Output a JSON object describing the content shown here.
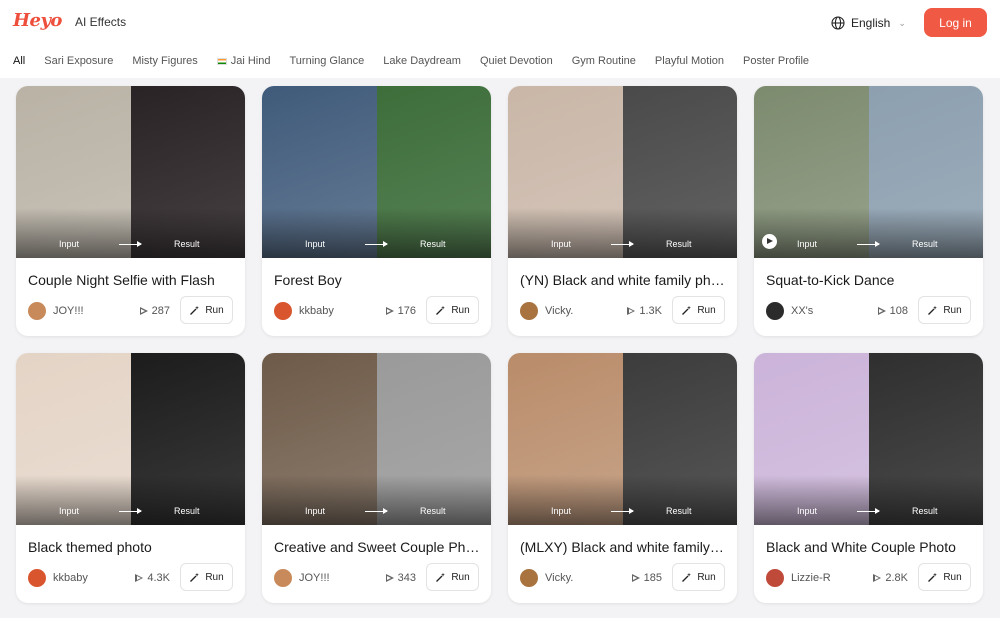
{
  "header": {
    "logo": "Heyo",
    "nav_link": "AI Effects",
    "language": "English",
    "login_label": "Log in"
  },
  "tabs": [
    {
      "label": "All",
      "active": true
    },
    {
      "label": "Sari Exposure"
    },
    {
      "label": "Misty Figures"
    },
    {
      "label": "Jai Hind",
      "flag": "india-flag"
    },
    {
      "label": "Turning Glance"
    },
    {
      "label": "Lake Daydream"
    },
    {
      "label": "Quiet Devotion"
    },
    {
      "label": "Gym Routine"
    },
    {
      "label": "Playful Motion"
    },
    {
      "label": "Poster Profile"
    }
  ],
  "labels": {
    "input": "Input",
    "result": "Result",
    "run": "Run"
  },
  "cards": [
    {
      "title": "Couple Night Selfie with Flash",
      "author": "JOY!!!",
      "plays": "287",
      "left_bg": "#b9b2a5",
      "right_bg": "#2a2326",
      "avatar": "#c88a5a"
    },
    {
      "title": "Forest Boy",
      "author": "kkbaby",
      "plays": "176",
      "left_bg": "#3f5a7a",
      "right_bg": "#3d6e3a",
      "avatar": "#d9552e"
    },
    {
      "title": "(YN) Black and white family photo",
      "author": "Vicky.",
      "plays": "1.3K",
      "left_bg": "#c9b6a7",
      "right_bg": "#4a4a4a",
      "avatar": "#a8733e"
    },
    {
      "title": "Squat-to-Kick Dance",
      "author": "XX's",
      "plays": "108",
      "left_bg": "#7c8a6e",
      "right_bg": "#8da0b0",
      "avatar": "#2b2b2b",
      "play_icon": true
    },
    {
      "title": "Black themed photo",
      "author": "kkbaby",
      "plays": "4.3K",
      "left_bg": "#e4d4c6",
      "right_bg": "#1c1c1c",
      "avatar": "#d9552e"
    },
    {
      "title": "Creative and Sweet Couple Photo",
      "author": "JOY!!!",
      "plays": "343",
      "left_bg": "#6e5a48",
      "right_bg": "#9a9a9a",
      "avatar": "#c88a5a"
    },
    {
      "title": "(MLXY) Black and white family photo",
      "author": "Vicky.",
      "plays": "185",
      "left_bg": "#b98c6a",
      "right_bg": "#3c3c3c",
      "avatar": "#a8733e"
    },
    {
      "title": "Black and White Couple Photo",
      "author": "Lizzie-R",
      "plays": "2.8K",
      "left_bg": "#cbb3d9",
      "right_bg": "#2f2f2f",
      "avatar": "#c04a3a"
    }
  ]
}
